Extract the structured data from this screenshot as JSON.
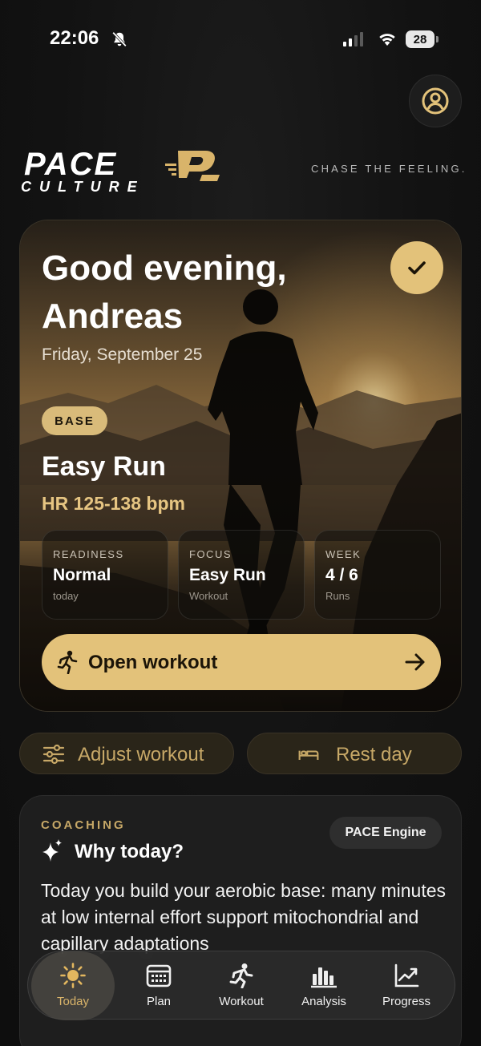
{
  "status_bar": {
    "time": "22:06",
    "battery": "28"
  },
  "brand": {
    "name": "PACE",
    "sub": "CULTURE",
    "tagline": "CHASE THE FEELING."
  },
  "hero": {
    "greeting": "Good evening,\nAndreas",
    "date": "Friday, September 25",
    "phase_badge": "BASE",
    "workout_title": "Easy Run",
    "hr_zone": "HR 125-138 bpm",
    "stats": [
      {
        "label": "READINESS",
        "value": "Normal",
        "sub": "today"
      },
      {
        "label": "FOCUS",
        "value": "Easy Run",
        "sub": "Workout"
      },
      {
        "label": "WEEK",
        "value": "4 / 6",
        "sub": "Runs"
      }
    ],
    "open_button": "Open workout"
  },
  "actions": {
    "adjust": "Adjust workout",
    "rest": "Rest day"
  },
  "coaching": {
    "label": "COACHING",
    "engine_badge": "PACE Engine",
    "title": "Why today?",
    "body": "Today you build your aerobic base: many minutes at low internal effort support mitochondrial and capillary adaptations"
  },
  "tabs": [
    {
      "label": "Today",
      "icon": "sun-icon",
      "active": true
    },
    {
      "label": "Plan",
      "icon": "calendar-icon"
    },
    {
      "label": "Workout",
      "icon": "runner-icon"
    },
    {
      "label": "Analysis",
      "icon": "bar-chart-icon"
    },
    {
      "label": "Progress",
      "icon": "trend-chart-icon"
    }
  ],
  "colors": {
    "accent": "#E3C27A",
    "background": "#111111",
    "card": "#1E1E1E"
  }
}
